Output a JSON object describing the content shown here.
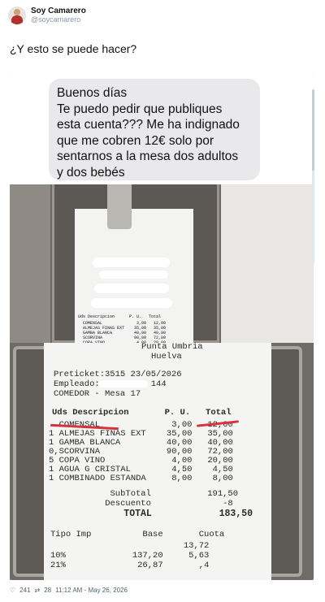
{
  "header": {
    "display_name": "Soy Camarero",
    "handle": "@soycamarero"
  },
  "tweet": {
    "text": "¿Y esto se puede hacer?"
  },
  "message_bubble": {
    "lines": [
      "Buenos días",
      "Te puedo pedir que publiques",
      "esta cuenta??? Me ha indignado",
      "que me cobren 12€ solo por",
      "sentarnos a la mesa dos adultos",
      "y dos bebés"
    ]
  },
  "receipt_small": {
    "header_row": "Uds Descripcion      P. U.   Total",
    "lines": [
      "  COMENSAL              3,00   12,00",
      "  ALMEJAS FINAS EXT    35,00   35,00",
      "  GAMBA BLANCA         40,00   40,00",
      "  SCORVINA             90,00   72,00",
      "  COPA VINO             4,00   20,00"
    ]
  },
  "receipt": {
    "place": "Punta Umbria",
    "town": "Huelva",
    "ticket": "Preticket:3515 23/05/2026",
    "employee": "Empleado:          144",
    "room": "COMEDOR - Mesa 17",
    "header_row": "Uds Descripcion       P. U.   Total",
    "items": [
      "  COMENSAL              3,00   12,00",
      "1 ALMEJAS FINAS EXT    35,00   35,00",
      "1 GAMBA BLANCA         40,00   40,00",
      "0,SCORVINA             90,00   72,00",
      "5 COPA VINO             4,00   20,00",
      "1 AGUA G CRISTAL        4,50    4,50",
      "1 COMBINADO ESTANDA     8,00    8,00"
    ],
    "subtotal": "     SubTotal           191,50",
    "discount": "    Descuento              -8",
    "total": "       TOTAL            183,50",
    "tax_header": "Tipo Imp          Base       Cuota",
    "tax_rows": [
      "                          13,72",
      "10%             137,20     5,63",
      "21%              26,87       ,4"
    ]
  },
  "footer": {
    "likes": "241",
    "retweets": "28",
    "time": "11:12 AM - May 26, 2026"
  }
}
